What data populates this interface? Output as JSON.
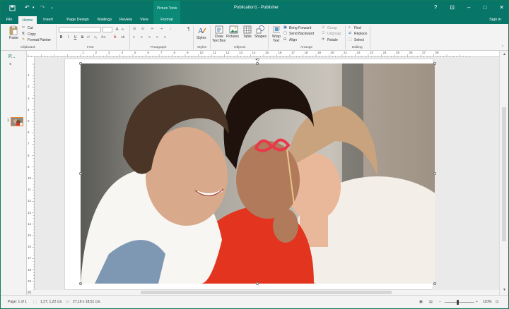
{
  "title_bar": {
    "window_title": "Publication1 - Publisher",
    "contextual_group": "Picture Tools",
    "help": "?",
    "controls": {
      "ribbon_options": "⊡",
      "minimize": "–",
      "maximize": "□",
      "close": "✕"
    }
  },
  "tabs": [
    {
      "label": "File"
    },
    {
      "label": "Home"
    },
    {
      "label": "Insert"
    },
    {
      "label": "Page Design"
    },
    {
      "label": "Mailings"
    },
    {
      "label": "Review"
    },
    {
      "label": "View"
    },
    {
      "label": "Format"
    }
  ],
  "sign_in": "Sign in",
  "ribbon": {
    "clipboard": {
      "paste": "Paste",
      "cut": "Cut",
      "copy": "Copy",
      "format_painter": "Format Painter",
      "label": "Clipboard"
    },
    "font": {
      "label": "Font",
      "bold": "B",
      "italic": "I",
      "underline": "U",
      "strike": "S",
      "grow": "A",
      "shrink": "A",
      "clear": "Aa"
    },
    "paragraph": {
      "label": "Paragraph"
    },
    "styles": {
      "styles": "Styles",
      "label": "Styles"
    },
    "objects": {
      "draw_text_box_1": "Draw",
      "draw_text_box_2": "Text Box",
      "pictures": "Pictures",
      "table": "Table",
      "shapes": "Shapes",
      "label": "Objects"
    },
    "arrange": {
      "wrap_1": "Wrap",
      "wrap_2": "Text",
      "bring_forward": "Bring Forward",
      "send_backward": "Send Backward",
      "align": "Align",
      "group": "Group",
      "ungroup": "Ungroup",
      "rotate": "Rotate",
      "label": "Arrange"
    },
    "editing": {
      "find": "Find",
      "replace": "Replace",
      "select": "Select",
      "label": "Editing"
    }
  },
  "panel": {
    "title": "P...",
    "page_number": "1"
  },
  "hruler_numbers": [
    "1",
    "2",
    "3",
    "4",
    "5",
    "6",
    "7",
    "8",
    "9",
    "10",
    "11",
    "12",
    "13",
    "14",
    "15",
    "16",
    "17",
    "18",
    "19",
    "20",
    "21",
    "22",
    "23",
    "24",
    "25",
    "26",
    "27",
    "28"
  ],
  "vruler_numbers": [
    "1",
    "2",
    "3",
    "4",
    "5",
    "6",
    "7",
    "8",
    "9",
    "10",
    "11",
    "12",
    "13",
    "14",
    "15",
    "16",
    "17",
    "18",
    "19",
    "20"
  ],
  "status_bar": {
    "page": "Page: 1 of 1",
    "position": "1,27; 1,22 cm.",
    "size": "27,16 x 18,51 cm.",
    "zoom": "110%"
  },
  "colors": {
    "accent": "#077568",
    "selected_thumb_border": "#e7883a"
  }
}
